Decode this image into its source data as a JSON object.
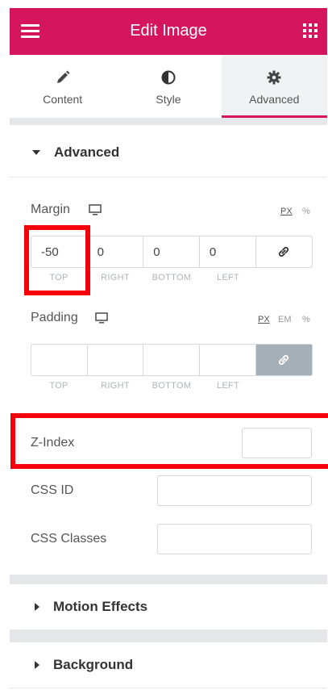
{
  "header": {
    "title": "Edit Image"
  },
  "tabs": [
    {
      "label": "Content",
      "icon": "pencil-icon"
    },
    {
      "label": "Style",
      "icon": "contrast-icon"
    },
    {
      "label": "Advanced",
      "icon": "gear-icon",
      "active": true
    }
  ],
  "advanced_section": {
    "title": "Advanced",
    "margin": {
      "label": "Margin",
      "units": [
        "PX",
        "%"
      ],
      "selected_unit": "PX",
      "values": {
        "top": "-50",
        "right": "0",
        "bottom": "0",
        "left": "0"
      },
      "sides": [
        "TOP",
        "RIGHT",
        "BOTTOM",
        "LEFT"
      ]
    },
    "padding": {
      "label": "Padding",
      "units": [
        "PX",
        "EM",
        "%"
      ],
      "selected_unit": "PX",
      "values": {
        "top": "",
        "right": "",
        "bottom": "",
        "left": ""
      },
      "sides": [
        "TOP",
        "RIGHT",
        "BOTTOM",
        "LEFT"
      ]
    },
    "z_index": {
      "label": "Z-Index",
      "value": ""
    },
    "css_id": {
      "label": "CSS ID",
      "value": ""
    },
    "css_classes": {
      "label": "CSS Classes",
      "value": ""
    }
  },
  "collapsed_sections": [
    {
      "title": "Motion Effects"
    },
    {
      "title": "Background"
    }
  ],
  "colors": {
    "brand": "#d5155e",
    "highlight": "#f5000a",
    "link_active": "#a4afb7"
  }
}
